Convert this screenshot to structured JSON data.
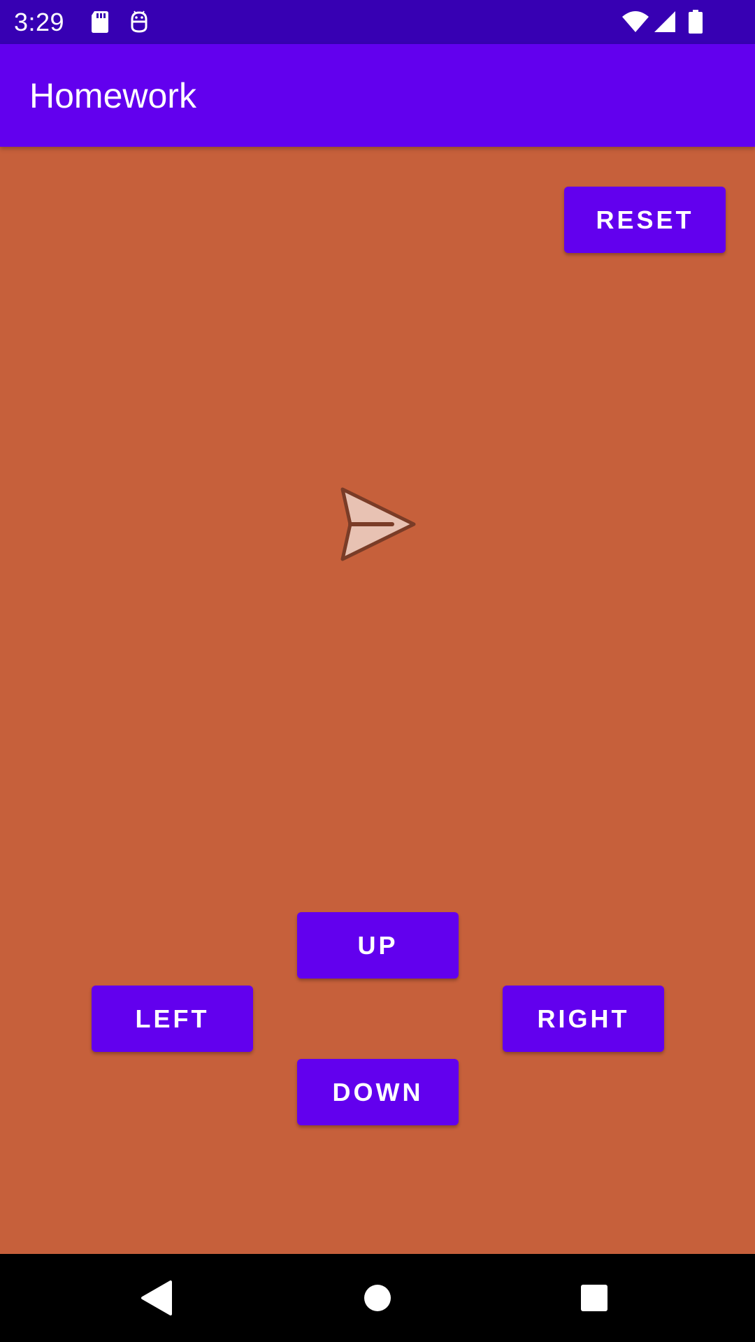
{
  "status_bar": {
    "time": "3:29",
    "icons_left": [
      "sd-card-icon",
      "android-debug-icon"
    ],
    "icons_right": [
      "wifi-icon",
      "cell-signal-icon",
      "battery-icon"
    ]
  },
  "app_bar": {
    "title": "Homework"
  },
  "controls": {
    "reset_label": "RESET",
    "up_label": "UP",
    "left_label": "LEFT",
    "right_label": "RIGHT",
    "down_label": "DOWN"
  },
  "canvas": {
    "sprite": "paper-plane-icon",
    "direction": "right"
  },
  "nav_bar": {
    "icons": [
      "back-icon",
      "home-icon",
      "recents-icon"
    ]
  },
  "colors": {
    "status_bar": "#3700b3",
    "app_bar": "#6200ee",
    "button": "#6200ee",
    "background": "#c6603b",
    "plane_fill": "#e8c2b3",
    "plane_stroke": "#7a3c27"
  }
}
